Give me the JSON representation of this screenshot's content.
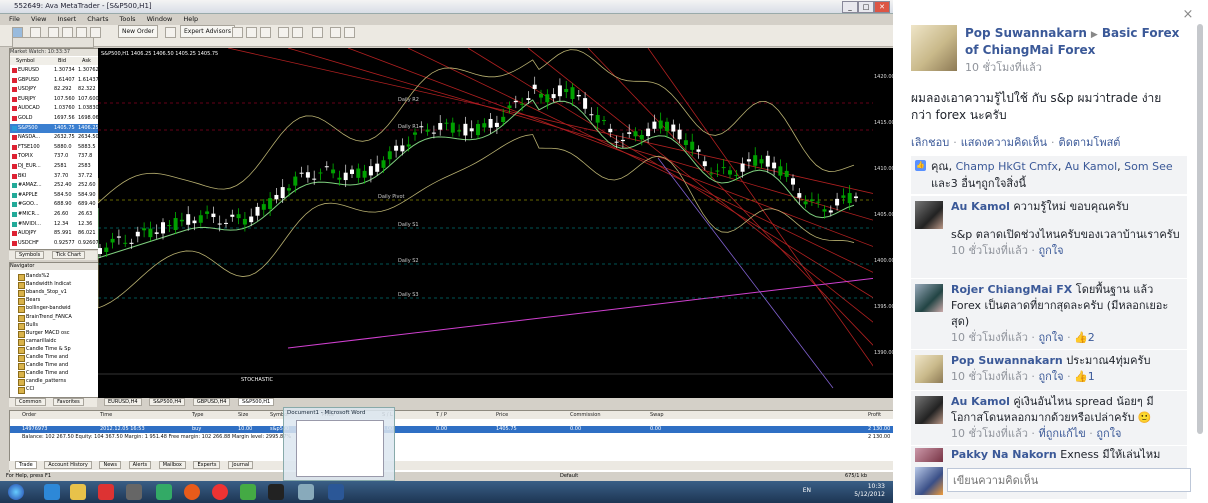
{
  "mt": {
    "title": "552649: Ava MetaTrader - [S&P500,H1]",
    "window_buttons": [
      "_",
      "□",
      "✕"
    ],
    "menu": [
      "File",
      "View",
      "Insert",
      "Charts",
      "Tools",
      "Window",
      "Help"
    ],
    "toolbar": {
      "new_order": "New Order",
      "expert_advisors": "Expert Advisors"
    },
    "market_watch": {
      "header": "Market Watch: 10:33:37",
      "columns": [
        "Symbol",
        "Bid",
        "Ask"
      ],
      "rows": [
        {
          "symbol": "EURUSD",
          "bid": "1.30734",
          "ask": "1.30762",
          "color": "#d23"
        },
        {
          "symbol": "GBPUSD",
          "bid": "1.61407",
          "ask": "1.61437",
          "color": "#d23"
        },
        {
          "symbol": "USDJPY",
          "bid": "82.292",
          "ask": "82.322",
          "color": "#d23"
        },
        {
          "symbol": "EURJPY",
          "bid": "107.560",
          "ask": "107.600",
          "color": "#d23"
        },
        {
          "symbol": "AUDCAD",
          "bid": "1.03760",
          "ask": "1.03830",
          "color": "#d23"
        },
        {
          "symbol": "GOLD",
          "bid": "1697.56",
          "ask": "1698.06",
          "color": "#d23"
        },
        {
          "symbol": "S&P500",
          "bid": "1405.75",
          "ask": "1406.25",
          "color": "#2a9ad8"
        },
        {
          "symbol": "NASDA...",
          "bid": "2632.75",
          "ask": "2634.50",
          "color": "#d23"
        },
        {
          "symbol": "FTSE100",
          "bid": "5880.0",
          "ask": "5883.5",
          "color": "#d23"
        },
        {
          "symbol": "TOPIX",
          "bid": "737.0",
          "ask": "737.8",
          "color": "#d23"
        },
        {
          "symbol": "DJ_EUR...",
          "bid": "2581",
          "ask": "2583",
          "color": "#d23"
        },
        {
          "symbol": "BKI",
          "bid": "37.70",
          "ask": "37.72",
          "color": "#d23"
        },
        {
          "symbol": "#AMAZ...",
          "bid": "252.40",
          "ask": "252.60",
          "color": "#2a9"
        },
        {
          "symbol": "#APPLE",
          "bid": "584.50",
          "ask": "584.90",
          "color": "#2a9"
        },
        {
          "symbol": "#GOO...",
          "bid": "688.90",
          "ask": "689.40",
          "color": "#2a9"
        },
        {
          "symbol": "#MICR...",
          "bid": "26.60",
          "ask": "26.63",
          "color": "#2a9"
        },
        {
          "symbol": "#NVIDI...",
          "bid": "12.34",
          "ask": "12.36",
          "color": "#2a9"
        },
        {
          "symbol": "AUDJPY",
          "bid": "85.991",
          "ask": "86.021",
          "color": "#d23"
        },
        {
          "symbol": "USDCHF",
          "bid": "0.92577",
          "ask": "0.92607",
          "color": "#d23"
        }
      ]
    },
    "mw_tabs": [
      "Symbols",
      "Tick Chart"
    ],
    "navigator": {
      "header": "Navigator",
      "items": [
        "Bands%2",
        "Bandwidth Indicat",
        "bbands_Stop_v1",
        "Bears",
        "bollinger-bandwid",
        "BrainTrend_FANCA",
        "Bulls",
        "Burger MACD osc",
        "camarillaidc",
        "Candle Time & Sp",
        "Candle Time and",
        "Candle Time and",
        "Candle Time and",
        "candle_patterns",
        "CCI"
      ]
    },
    "nav_tabs": [
      "Common",
      "Favorites"
    ],
    "chart": {
      "info": "S&P500,H1  1406.25 1406.50 1405.25 1405.75",
      "levels": [
        "Daily R2",
        "Daily R1",
        "Daily Pivot",
        "Daily S1",
        "Daily S2",
        "Daily S3"
      ],
      "indicator": "STOCHASTIC",
      "price_labels": [
        "1420.00",
        "1415.00",
        "1410.00",
        "1405.00",
        "1400.00",
        "1395.00",
        "1390.00"
      ]
    },
    "chart_tabs": [
      "EURUSD,H4",
      "S&P500,H4",
      "GBPUSD,H4",
      "S&P500,H1"
    ],
    "terminal": {
      "columns": [
        "Order",
        "Time",
        "Type",
        "Size",
        "Symbol",
        "Price",
        "S / L",
        "T / P",
        "Price",
        "Commission",
        "Swap",
        "Profit"
      ],
      "row": [
        "14976973",
        "2012.12.05 16:53",
        "buy",
        "10.00",
        "s&p500",
        "1400.75",
        "0.00",
        "0.00",
        "1405.75",
        "0.00",
        "0.00",
        "2 130.00"
      ],
      "balance": "Balance: 102 267.50  Equity: 104 367.50  Margin: 1 951.48  Free margin: 102 266.88  Margin level: 2995.87%",
      "balance_profit": "2 130.00"
    },
    "term_tabs": [
      "Trade",
      "Account History",
      "News",
      "Alerts",
      "Mailbox",
      "Experts",
      "Journal"
    ],
    "status": {
      "help": "For Help, press F1",
      "profile": "Default",
      "traffic": "675/1 kb"
    },
    "word_popup": "Document1 - Microsoft Word",
    "tray": {
      "lang": "EN",
      "time": "10:33",
      "date": "5/12/2012"
    }
  },
  "fb": {
    "close_label": "×",
    "poster": "Pop Suwannakarn",
    "group": "Basic Forex of ChiangMai Forex",
    "time": "10 ชั่วโมงที่แล้ว",
    "text": "ผมลองเอาความรู้ไปใช้ กับ s&p ผมว่าtrade ง่ายกว่า forex นะครับ",
    "actions": [
      "เลิกชอบ",
      "แสดงความคิดเห็น",
      "ติดตามโพสต์"
    ],
    "likes_prefix": "คุณ,",
    "likers": [
      "Champ HkGt Cmfx",
      "Au Kamol",
      "Som See"
    ],
    "likes_suffix": "และ3 อื่นๆถูกใจสิ่งนี้",
    "comments": [
      {
        "name": "Au Kamol",
        "text": "ความรู้ใหม่ ขอบคุณครับ",
        "text2": "s&p ตลาดเปิดช่วงไหนครับของเวลาบ้านเราครับ",
        "time": "10 ชั่วโมงที่แล้ว",
        "action": "ถูกใจ",
        "likes": ""
      },
      {
        "name": "Rojer ChiangMai FX",
        "text": "โดยพื้นฐาน แล้ว Forex เป็นตลาดที่ยากสุดละครับ (มีหลอกเยอะสุด)",
        "time": "10 ชั่วโมงที่แล้ว",
        "action": "ถูกใจ",
        "likes": "2"
      },
      {
        "name": "Pop Suwannakarn",
        "text": "ประมาณ4ทุ่มครับ",
        "time": "10 ชั่วโมงที่แล้ว",
        "action": "ถูกใจ",
        "likes": "1"
      },
      {
        "name": "Au Kamol",
        "text": "คู่เงินอันไหน spread น้อยๆ มีโอกาสโดนหลอกมากด้วยหรือเปล่าครับ 🙂",
        "time": "10 ชั่วโมงที่แล้ว",
        "action": "ถูกใจ",
        "edited": "ที่ถูกแก้ไข",
        "likes": ""
      },
      {
        "name": "Pakky Na Nakorn",
        "text": "Exness มีให้เล่นไหม",
        "time": "",
        "action": "",
        "likes": ""
      }
    ],
    "comment_placeholder": "เขียนความคิดเห็น"
  }
}
